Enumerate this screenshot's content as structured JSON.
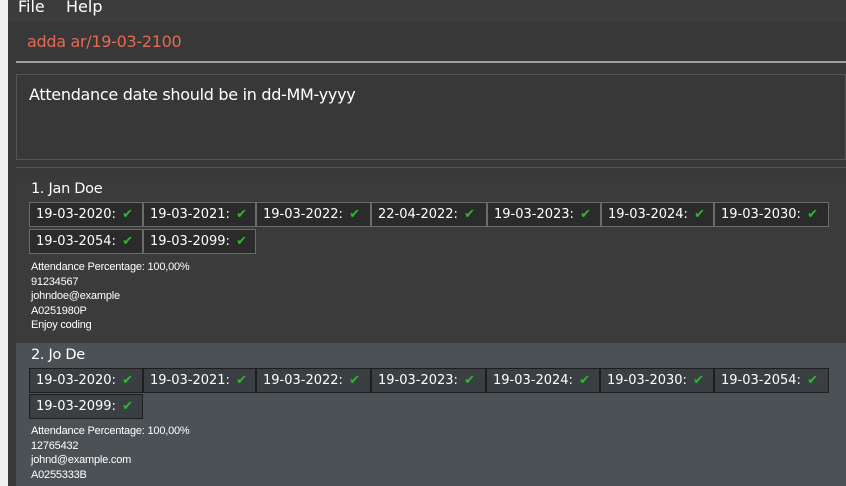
{
  "menu": {
    "file": "File",
    "help": "Help"
  },
  "command": {
    "value": "adda ar/19-03-2100"
  },
  "result": {
    "message": "Attendance date should be in dd-MM-yyyy"
  },
  "colors": {
    "command_text": "#e46a55",
    "check": "#2eb82e",
    "selected_card": "#4c5155"
  },
  "persons": [
    {
      "header": "1.  Jan Doe",
      "dates": [
        "19-03-2020:",
        "19-03-2021:",
        "19-03-2022:",
        "22-04-2022:",
        "19-03-2023:",
        "19-03-2024:",
        "19-03-2030:",
        "19-03-2054:",
        "19-03-2099:"
      ],
      "check_icon": "checkmark-icon",
      "percentage": "Attendance Percentage: 100,00%",
      "phone": "91234567",
      "email": "johndoe@example",
      "matric": "A0251980P",
      "remark": "Enjoy coding"
    },
    {
      "header": "2.  Jo De",
      "dates": [
        "19-03-2020:",
        "19-03-2021:",
        "19-03-2022:",
        "19-03-2023:",
        "19-03-2024:",
        "19-03-2030:",
        "19-03-2054:",
        "19-03-2099:"
      ],
      "check_icon": "checkmark-icon",
      "percentage": "Attendance Percentage: 100,00%",
      "phone": "12765432",
      "email": "johnd@example.com",
      "matric": "A0255333B"
    }
  ]
}
